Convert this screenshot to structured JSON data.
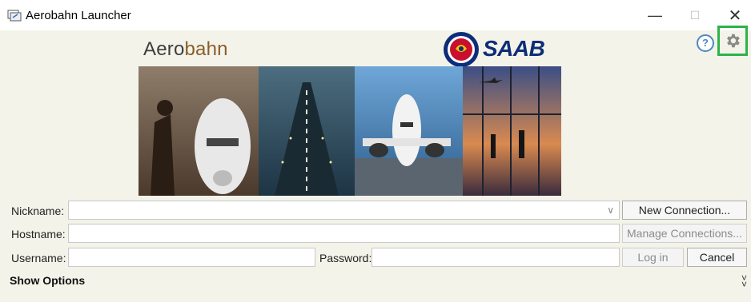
{
  "window": {
    "title": "Aerobahn Launcher",
    "minimize_glyph": "—",
    "maximize_glyph": "☐",
    "close_glyph": "✕"
  },
  "branding": {
    "product_name_part1": "Aero",
    "product_name_part2": "bahn",
    "company_name": "SAAB"
  },
  "toolbar": {
    "help_glyph": "?",
    "help_icon": "help-circle-icon",
    "settings_icon": "gear-icon"
  },
  "form": {
    "nickname_label": "Nickname:",
    "nickname_value": "",
    "hostname_label": "Hostname:",
    "hostname_value": "",
    "username_label": "Username:",
    "username_value": "",
    "password_label": "Password:",
    "password_value": ""
  },
  "buttons": {
    "new_connection": "New Connection...",
    "manage_connections": "Manage Connections...",
    "log_in": "Log in",
    "cancel": "Cancel"
  },
  "options": {
    "show_options_label": "Show Options",
    "expand_glyph": "»"
  },
  "colors": {
    "highlight": "#2db34a",
    "brand_accent": "#8b5d2a",
    "saab_blue": "#0d2d78"
  }
}
